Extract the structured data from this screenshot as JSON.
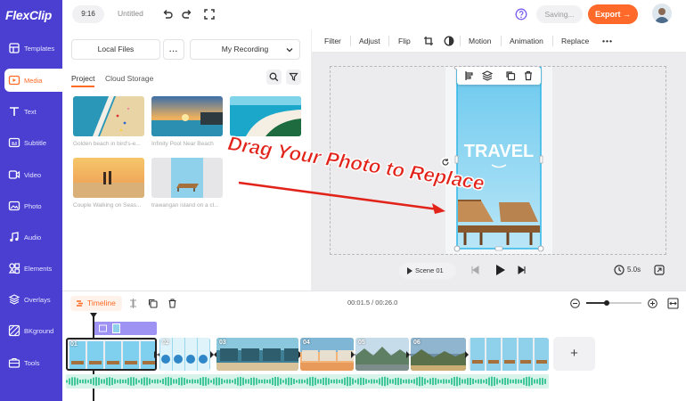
{
  "app": {
    "logo": "FlexClip",
    "brand_color": "#4a3fd1",
    "accent_color": "#ff6a25"
  },
  "topbar": {
    "ratio": "9:16",
    "title": "Untitled",
    "saving": "Saving...",
    "export": "Export"
  },
  "sidebar": {
    "items": [
      {
        "label": "Templates",
        "icon": "templates-icon"
      },
      {
        "label": "Media",
        "icon": "media-icon",
        "active": true
      },
      {
        "label": "Text",
        "icon": "text-icon"
      },
      {
        "label": "Subtitle",
        "icon": "subtitle-icon"
      },
      {
        "label": "Video",
        "icon": "video-icon"
      },
      {
        "label": "Photo",
        "icon": "photo-icon"
      },
      {
        "label": "Audio",
        "icon": "audio-icon"
      },
      {
        "label": "Elements",
        "icon": "elements-icon"
      },
      {
        "label": "Overlays",
        "icon": "overlays-icon"
      },
      {
        "label": "BKground",
        "icon": "background-icon"
      },
      {
        "label": "Tools",
        "icon": "tools-icon"
      }
    ]
  },
  "media": {
    "local_files": "Local Files",
    "more": "...",
    "recording": "My Recording",
    "tabs": [
      "Project",
      "Cloud Storage"
    ],
    "thumbnails": [
      {
        "caption": "Golden beach in bird's-e..."
      },
      {
        "caption": "Infinity Pool Near Beach"
      },
      {
        "caption": ""
      },
      {
        "caption": "Couple Walking on Seas..."
      },
      {
        "caption": "trawangan island on a cl..."
      }
    ]
  },
  "toolbar": {
    "items": [
      "Filter",
      "Adjust",
      "Flip",
      "Motion",
      "Animation",
      "Replace"
    ]
  },
  "canvas": {
    "overlay_word": "TRAVEL",
    "callout": "Drag Your Photo to Replace"
  },
  "preview": {
    "scene": "Scene 01",
    "duration": "5.0s"
  },
  "timeline": {
    "label": "Timeline",
    "timecode": "00:01.5 / 00:26.0",
    "zoom_level": 0.35,
    "clips": [
      "01",
      "02",
      "03",
      "04",
      "05",
      "06",
      ""
    ],
    "add": "+"
  }
}
